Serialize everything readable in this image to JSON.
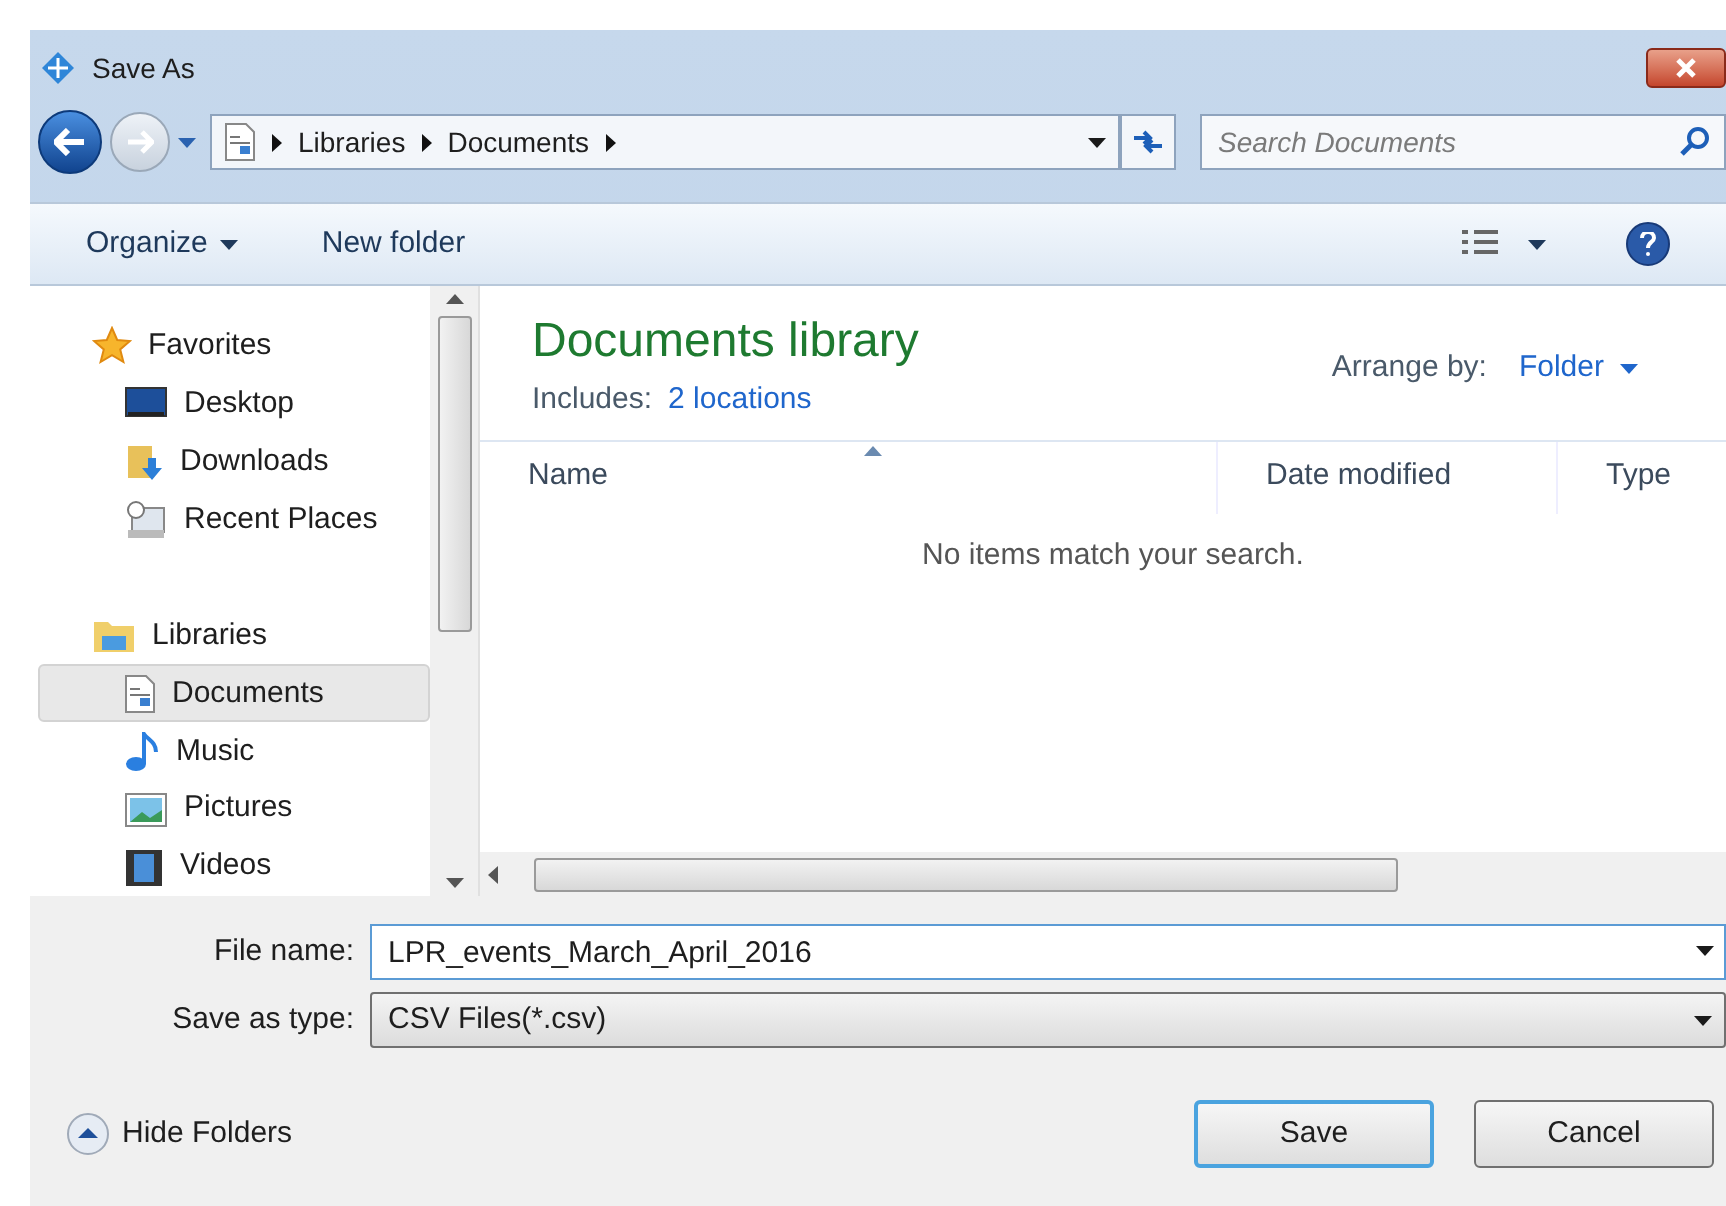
{
  "window": {
    "title": "Save As"
  },
  "address": {
    "crumbs": [
      "Libraries",
      "Documents"
    ]
  },
  "search": {
    "placeholder": "Search Documents"
  },
  "toolbar": {
    "organize": "Organize",
    "new_folder": "New folder"
  },
  "sidebar": {
    "items": [
      {
        "kind": "group",
        "label": "Favorites",
        "selected": false
      },
      {
        "kind": "item",
        "label": "Desktop",
        "selected": false
      },
      {
        "kind": "item",
        "label": "Downloads",
        "selected": false
      },
      {
        "kind": "item",
        "label": "Recent Places",
        "selected": false
      },
      {
        "kind": "spacer"
      },
      {
        "kind": "group",
        "label": "Libraries",
        "selected": false
      },
      {
        "kind": "item",
        "label": "Documents",
        "selected": true
      },
      {
        "kind": "item",
        "label": "Music",
        "selected": false
      },
      {
        "kind": "item",
        "label": "Pictures",
        "selected": false
      },
      {
        "kind": "item",
        "label": "Videos",
        "selected": false
      }
    ]
  },
  "library": {
    "title": "Documents library",
    "includes_label": "Includes:",
    "includes_link": "2 locations",
    "arrange_label": "Arrange by:",
    "arrange_value": "Folder"
  },
  "table": {
    "columns": [
      "Name",
      "Date modified",
      "Type"
    ],
    "empty_message": "No items match your search."
  },
  "form": {
    "file_name_label": "File name:",
    "file_name": "LPR_events_March_April_2016",
    "type_label": "Save as type:",
    "type_value": "CSV Files(*.csv)"
  },
  "hide_folders": "Hide Folders",
  "buttons": [
    "Save",
    "Cancel"
  ]
}
